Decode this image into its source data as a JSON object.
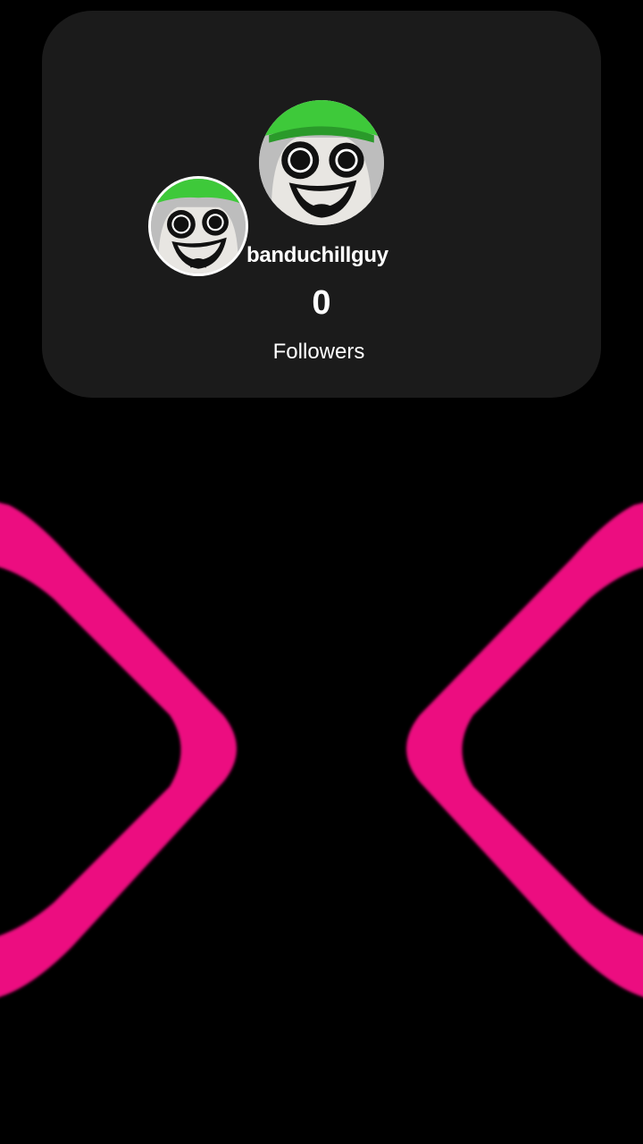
{
  "profile": {
    "username": "banduchillguy",
    "followers_count": "0",
    "followers_label": "Followers"
  },
  "colors": {
    "background": "#000000",
    "card": "#1b1b1b",
    "accent_pink": "#ec0a80",
    "avatar_hat_green": "#3ec93a"
  }
}
